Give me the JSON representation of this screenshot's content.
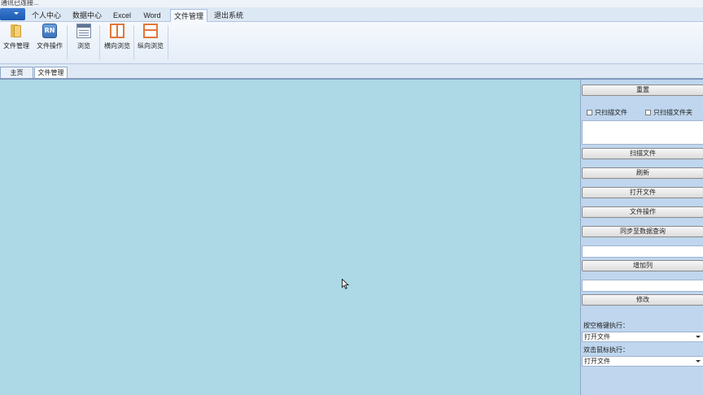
{
  "status": {
    "text": "通讯已连接..."
  },
  "ribbon": {
    "tabs": [
      {
        "label": "个人中心"
      },
      {
        "label": "数据中心"
      },
      {
        "label": "Excel"
      },
      {
        "label": "Word"
      },
      {
        "label": "文件管理"
      },
      {
        "label": "退出系统"
      }
    ],
    "buttons": [
      {
        "label": "文件管理",
        "icon": "folder-icon"
      },
      {
        "label": "文件操作",
        "icon": "rn-file-icon",
        "glyph": "RN"
      },
      {
        "label": "浏览",
        "icon": "document-browse-icon"
      },
      {
        "label": "横向浏览",
        "icon": "horizontal-layout-icon"
      },
      {
        "label": "纵向浏览",
        "icon": "vertical-layout-icon"
      }
    ]
  },
  "doc_tabs": [
    {
      "label": "主页"
    },
    {
      "label": "文件管理"
    }
  ],
  "main": {
    "background": "#add8e6"
  },
  "panel": {
    "reset_label": "重置",
    "scan_files_only": "只扫描文件",
    "scan_folders_only": "只扫描文件夹",
    "scan_label": "扫描文件",
    "refresh_label": "刷新",
    "open_label": "打开文件",
    "file_op_label": "文件操作",
    "sync_label": "同步至数据查询",
    "add_col_label": "增加列",
    "modify_label": "修改",
    "space_key_label": "按空格键执行：",
    "space_key_value": "打开文件",
    "double_click_label": "双击鼠标执行：",
    "double_click_value": "打开文件"
  }
}
